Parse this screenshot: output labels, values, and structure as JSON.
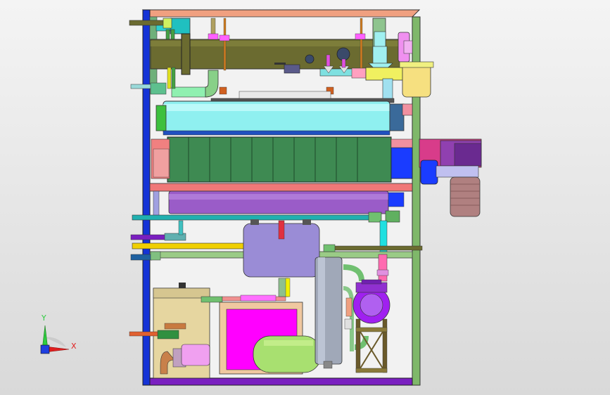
{
  "viewport": {
    "background_top": "#f4f4f4",
    "background_bottom": "#d9d9d9"
  },
  "triad": {
    "y_label": "Y",
    "x_label": "X",
    "y_color": "#2ecc40",
    "x_color": "#e01f1f",
    "z_color": "#1f3fe0"
  },
  "colors": {
    "frame_blue": "#1433d6",
    "frame_green": "#7fb86a",
    "frame_top": "#f0a080",
    "frame_bottom": "#7a1fc0",
    "pipe_olive": "#6b6b30",
    "tank_cyan": "#8ff0f0",
    "heat_exchanger": "#3e8a52",
    "pink_band": "#f07878",
    "purple_tank": "#9a5cc8",
    "lilac_tank": "#9a8cd6",
    "yellow_pipe": "#f0d000",
    "magenta_panel": "#ff00ff",
    "beige_box": "#e6d6a0",
    "light_green_tank": "#a8e070",
    "grey_column": "#a0a8b8",
    "violet_pump": "#a020f0",
    "motor_rose": "#b08080"
  },
  "icons": [
    "pressure-gauge-icon",
    "valve-icon",
    "pump-icon",
    "motor-icon",
    "tank-icon"
  ]
}
